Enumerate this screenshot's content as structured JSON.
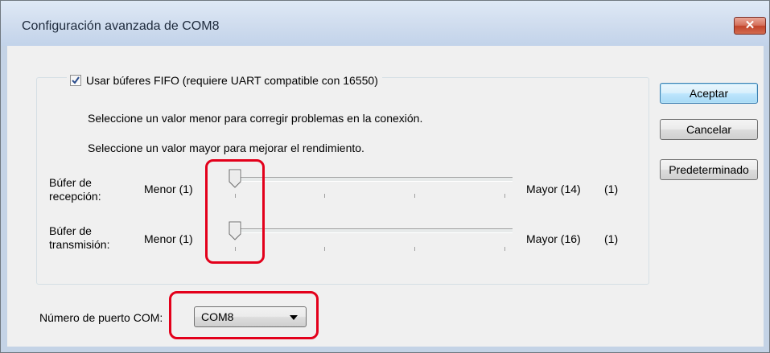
{
  "window": {
    "title": "Configuración avanzada de COM8",
    "close_glyph": "✕"
  },
  "fifo": {
    "label": "Usar búferes FIFO (requiere UART compatible con 16550)",
    "checked": true
  },
  "hints": {
    "lower": "Seleccione un valor menor para corregir problemas en la conexión.",
    "higher": "Seleccione un valor mayor para mejorar el rendimiento."
  },
  "receive": {
    "label_line1": "Búfer de",
    "label_line2": "recepción:",
    "min_label": "Menor (1)",
    "max_label": "Mayor (14)",
    "current_label": "(1)",
    "value": 1,
    "min": 1,
    "max": 14
  },
  "transmit": {
    "label_line1": "Búfer de",
    "label_line2": "transmisión:",
    "min_label": "Menor (1)",
    "max_label": "Mayor (16)",
    "current_label": "(1)",
    "value": 1,
    "min": 1,
    "max": 16
  },
  "port": {
    "label": "Número de puerto COM:",
    "selected": "COM8"
  },
  "buttons": {
    "ok": "Aceptar",
    "cancel": "Cancelar",
    "defaults": "Predeterminado"
  },
  "colors": {
    "highlight": "#e3001b",
    "close_button": "#c2432a"
  }
}
